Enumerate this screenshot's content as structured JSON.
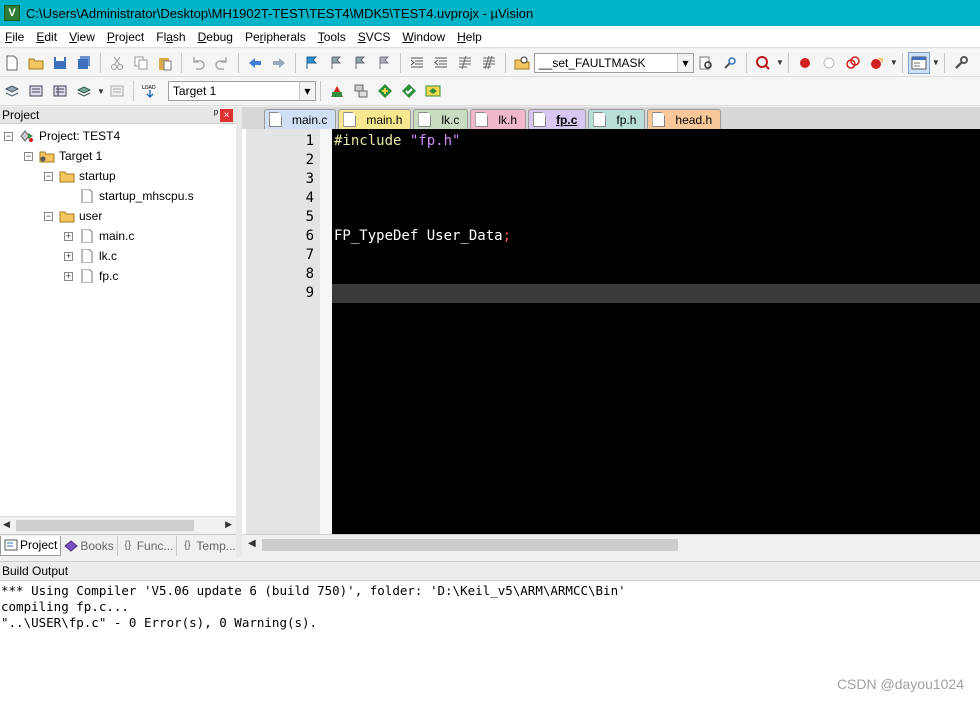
{
  "window": {
    "title": "C:\\Users\\Administrator\\Desktop\\MH1902T-TEST\\TEST4\\MDK5\\TEST4.uvprojx - µVision",
    "icon_letter": "V"
  },
  "menu": [
    {
      "pre": "",
      "u": "F",
      "post": "ile"
    },
    {
      "pre": "",
      "u": "E",
      "post": "dit"
    },
    {
      "pre": "",
      "u": "V",
      "post": "iew"
    },
    {
      "pre": "",
      "u": "P",
      "post": "roject"
    },
    {
      "pre": "Fl",
      "u": "a",
      "post": "sh"
    },
    {
      "pre": "",
      "u": "D",
      "post": "ebug"
    },
    {
      "pre": "Pe",
      "u": "r",
      "post": "ipherals"
    },
    {
      "pre": "",
      "u": "T",
      "post": "ools"
    },
    {
      "pre": "",
      "u": "S",
      "post": "VCS"
    },
    {
      "pre": "",
      "u": "W",
      "post": "indow"
    },
    {
      "pre": "",
      "u": "H",
      "post": "elp"
    }
  ],
  "toolbar": {
    "find_combo_value": "__set_FAULTMASK",
    "target_combo_value": "Target 1"
  },
  "project_panel": {
    "title": "Project",
    "pin": "ᵖ",
    "close": "×",
    "tree": {
      "project": "Project: TEST4",
      "target": "Target 1",
      "group_startup": "startup",
      "file_startup": "startup_mhscpu.s",
      "group_user": "user",
      "file_main": "main.c",
      "file_lk": "lk.c",
      "file_fp": "fp.c"
    },
    "tabs": [
      "Project",
      "Books",
      "Func...",
      "Temp..."
    ]
  },
  "editor": {
    "tabs": [
      {
        "label": "main.c",
        "color": "#cfe0f5"
      },
      {
        "label": "main.h",
        "color": "#f7e78f"
      },
      {
        "label": "lk.c",
        "color": "#c8dcc0"
      },
      {
        "label": "lk.h",
        "color": "#f0b8c8"
      },
      {
        "label": "fp.c",
        "color": "#d6c8f0",
        "active": true
      },
      {
        "label": "fp.h",
        "color": "#b8e0d8"
      },
      {
        "label": "head.h",
        "color": "#f8c89a"
      }
    ],
    "line_numbers": [
      "1",
      "2",
      "3",
      "4",
      "5",
      "6",
      "7",
      "8",
      "9"
    ],
    "code": {
      "l1_kw": "#include",
      "l1_str": "\"fp.h\"",
      "l6_text": "FP_TypeDef User_Data",
      "l6_punc": ";"
    },
    "current_line": 9
  },
  "build_output": {
    "title": "Build Output",
    "lines": [
      "*** Using Compiler 'V5.06 update 6 (build 750)', folder: 'D:\\Keil_v5\\ARM\\ARMCC\\Bin'",
      "compiling fp.c...",
      "\"..\\USER\\fp.c\" - 0 Error(s), 0 Warning(s)."
    ]
  },
  "watermark": "CSDN @dayou1024",
  "colors": {
    "titlebar": "#00b4c8",
    "editor_bg": "#000000",
    "keyword": "#e8e8a0",
    "string": "#d28cff",
    "punctuation": "#ff5a5a"
  }
}
